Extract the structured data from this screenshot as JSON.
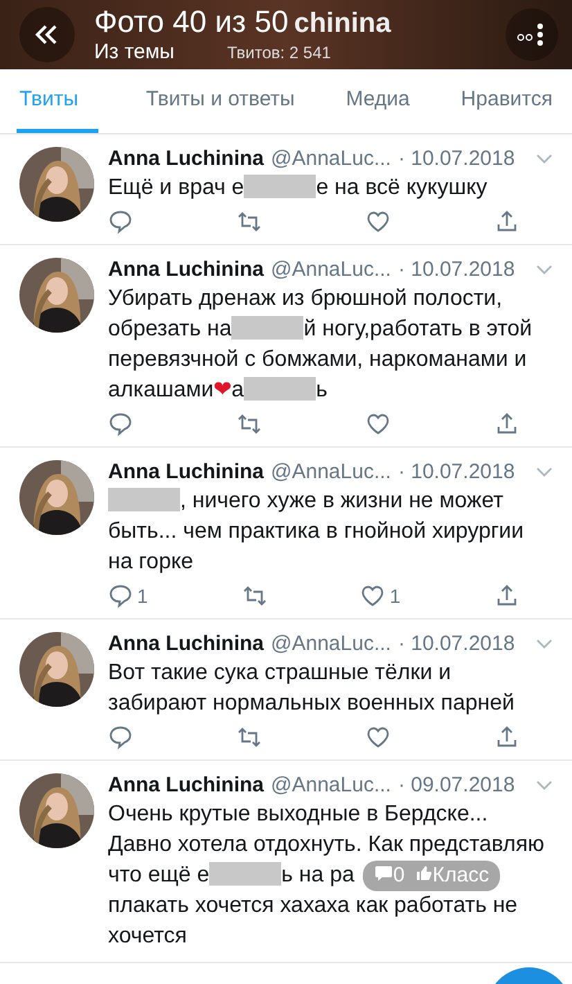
{
  "viewer": {
    "title": "Фото 40 из 50",
    "subtitle": "Из темы",
    "profile_name_visible": "chinina",
    "tweet_count": "Твитов: 2 541"
  },
  "tabs": [
    {
      "label": "Твиты",
      "selected": true
    },
    {
      "label": "Твиты и ответы",
      "selected": false
    },
    {
      "label": "Медиа",
      "selected": false
    },
    {
      "label": "Нравится",
      "selected": false
    }
  ],
  "tweets": [
    {
      "name": "Anna Luchinina",
      "handle": "@AnnaLuc...",
      "date": "· 10.07.2018",
      "text": [
        {
          "kind": "text",
          "value": "Ещё и врач е"
        },
        {
          "kind": "censor"
        },
        {
          "kind": "text",
          "value": "е на всё кукушку"
        }
      ],
      "actions": [
        {
          "kind": "reply"
        },
        {
          "kind": "retweet"
        },
        {
          "kind": "like"
        },
        {
          "kind": "share"
        }
      ]
    },
    {
      "name": "Anna Luchinina",
      "handle": "@AnnaLuc...",
      "date": "· 10.07.2018",
      "text": [
        {
          "kind": "text",
          "value": "Убирать дренаж из брюшной полости, обрезать на"
        },
        {
          "kind": "censor"
        },
        {
          "kind": "text",
          "value": "й ногу,работать в этой перевязчной с бомжами, наркоманами и алкашами"
        },
        {
          "kind": "emoji",
          "value": "❤"
        },
        {
          "kind": "text",
          "value": "а"
        },
        {
          "kind": "censor"
        },
        {
          "kind": "text",
          "value": "ь"
        }
      ],
      "actions": [
        {
          "kind": "reply"
        },
        {
          "kind": "retweet"
        },
        {
          "kind": "like"
        },
        {
          "kind": "share"
        }
      ]
    },
    {
      "name": "Anna Luchinina",
      "handle": "@AnnaLuc...",
      "date": "· 10.07.2018",
      "text": [
        {
          "kind": "censor"
        },
        {
          "kind": "text",
          "value": ", ничего хуже в жизни не может быть... чем практика в гнойной хирургии на горке"
        }
      ],
      "actions": [
        {
          "kind": "reply",
          "count": "1"
        },
        {
          "kind": "retweet"
        },
        {
          "kind": "like",
          "count": "1"
        },
        {
          "kind": "share"
        }
      ]
    },
    {
      "name": "Anna Luchinina",
      "handle": "@AnnaLuc...",
      "date": "· 10.07.2018",
      "text": [
        {
          "kind": "text",
          "value": "Вот такие сука страшные тёлки и забирают нормальных военных парней"
        }
      ],
      "actions": [
        {
          "kind": "reply"
        },
        {
          "kind": "retweet"
        },
        {
          "kind": "like"
        },
        {
          "kind": "share"
        }
      ]
    },
    {
      "name": "Anna Luchinina",
      "handle": "@AnnaLuc...",
      "date": "· 09.07.2018",
      "text": [
        {
          "kind": "text",
          "value": "Очень крутые выходные в Бердске... Давно хотела отдохнуть. Как представляю что ещё е"
        },
        {
          "kind": "censor"
        },
        {
          "kind": "text",
          "value": "ь на ра"
        },
        {
          "kind": "overlay",
          "comments": "0",
          "like": "Класс"
        },
        {
          "kind": "text",
          "value": "плакать хочется хахаха как работать не хочется"
        }
      ]
    }
  ]
}
